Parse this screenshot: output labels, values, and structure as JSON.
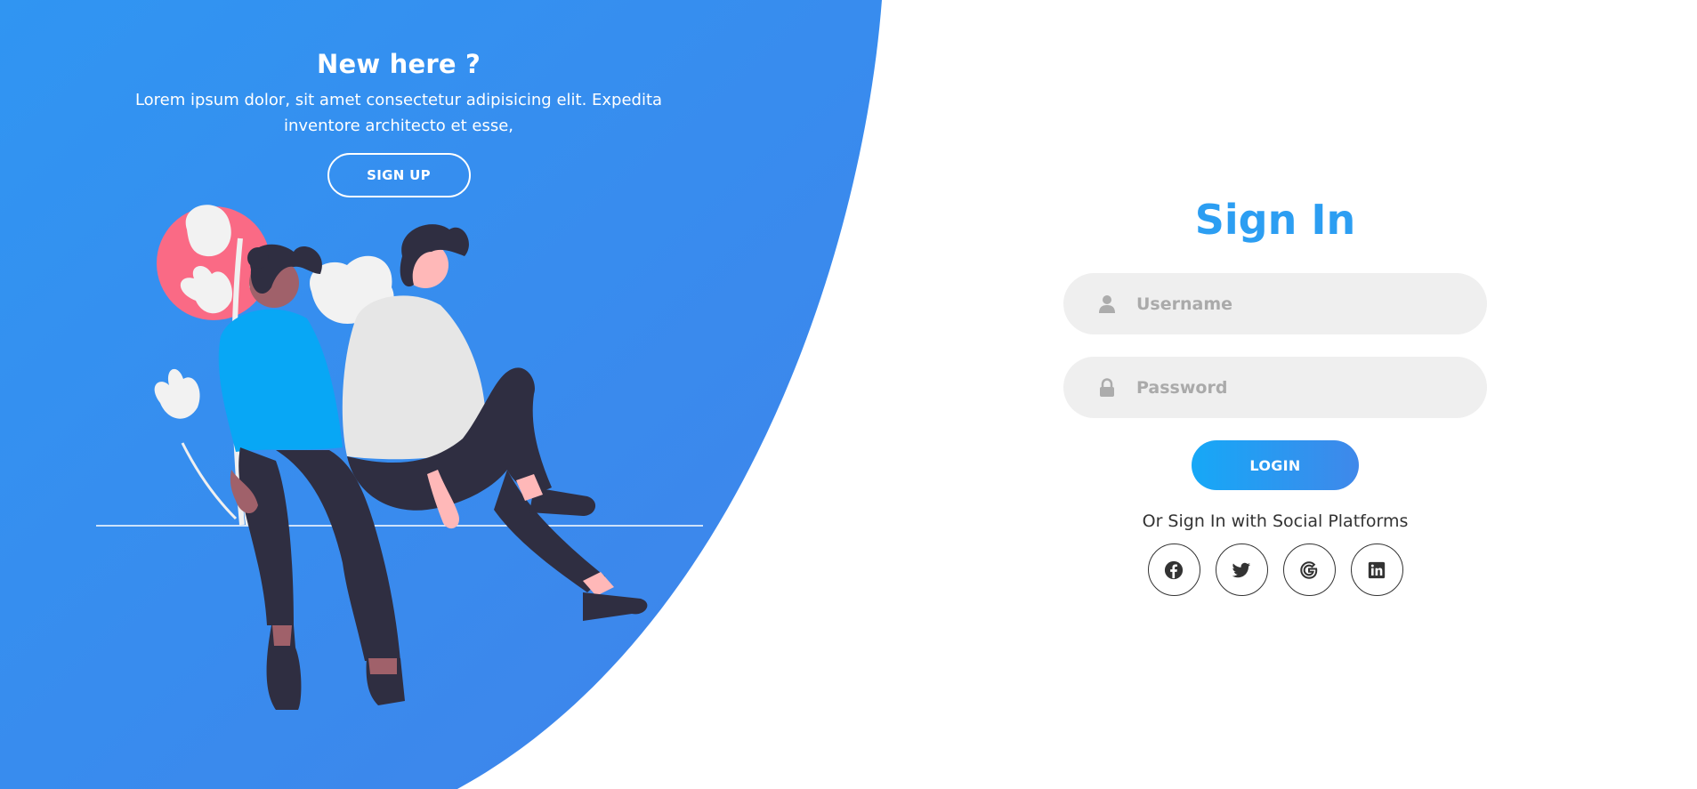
{
  "left_panel": {
    "title": "New here ?",
    "text": "Lorem ipsum dolor, sit amet consectetur adipisicing elit. Expedita inventore architecto et esse,",
    "signup_label": "SIGN UP"
  },
  "signin": {
    "title": "Sign In",
    "username_placeholder": "Username",
    "password_placeholder": "Password",
    "login_label": "LOGIN",
    "social_text": "Or Sign In with Social Platforms",
    "social_icons": [
      "facebook-icon",
      "twitter-icon",
      "google-icon",
      "linkedin-icon"
    ]
  },
  "colors": {
    "panel_gradient_start": "#3095f2",
    "panel_gradient_end": "#4083ea",
    "title_blue": "#2c9ef2",
    "input_bg": "#efefef",
    "login_gradient_start": "#16a8f7",
    "login_gradient_end": "#3f88ea"
  }
}
